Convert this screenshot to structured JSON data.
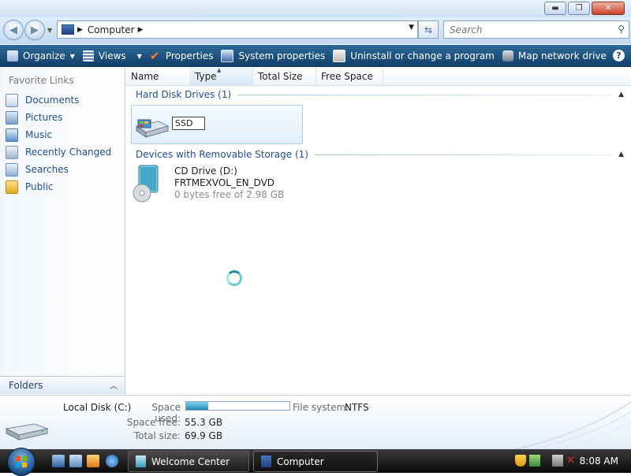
{
  "window": {
    "buttons": {
      "minimize": "▬",
      "maximize": "❐",
      "close": "✕"
    }
  },
  "address": {
    "location": "Computer",
    "search_placeholder": "Search"
  },
  "commandbar": {
    "items": [
      {
        "label": "Organize",
        "has_dropdown": true
      },
      {
        "label": "Views",
        "has_dropdown": true
      },
      {
        "label": "Properties",
        "has_dropdown": false
      },
      {
        "label": "System properties",
        "has_dropdown": false
      },
      {
        "label": "Uninstall or change a program",
        "has_dropdown": false
      },
      {
        "label": "Map network drive",
        "has_dropdown": false
      }
    ],
    "more": "»",
    "help": "?"
  },
  "navpane": {
    "title": "Favorite Links",
    "items": [
      {
        "label": "Documents",
        "icon": "documents-icon"
      },
      {
        "label": "Pictures",
        "icon": "pictures-icon"
      },
      {
        "label": "Music",
        "icon": "music-icon"
      },
      {
        "label": "Recently Changed",
        "icon": "recently-changed-icon"
      },
      {
        "label": "Searches",
        "icon": "searches-icon"
      },
      {
        "label": "Public",
        "icon": "public-folder-icon"
      }
    ],
    "folders_label": "Folders"
  },
  "columns": [
    "Name",
    "Type",
    "Total Size",
    "Free Space"
  ],
  "groups": {
    "hdd": {
      "title": "Hard Disk Drives (1)"
    },
    "removable": {
      "title": "Devices with Removable Storage (1)"
    }
  },
  "items": {
    "ssd": {
      "rename_value": "SSD"
    },
    "cd": {
      "name": "CD Drive (D:)",
      "label": "FRTMEXVOL_EN_DVD",
      "free": "0 bytes free of 2.98 GB"
    }
  },
  "details": {
    "name": "Local Disk (C:)",
    "space_used_label": "Space used:",
    "space_used_fraction": 0.21,
    "file_system_label": "File system:",
    "file_system": "NTFS",
    "space_free_label": "Space free:",
    "space_free": "55.3 GB",
    "total_size_label": "Total size:",
    "total_size": "69.9 GB"
  },
  "taskbar": {
    "tasks": [
      {
        "label": "Welcome Center",
        "active": false
      },
      {
        "label": "Computer",
        "active": true
      }
    ],
    "clock": "8:08 AM"
  }
}
